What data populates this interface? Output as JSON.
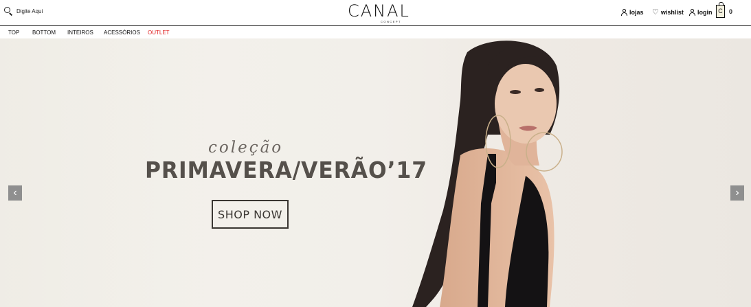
{
  "header": {
    "search_placeholder": "Digite Aqui",
    "logo_main": "CANAL",
    "logo_sub": "CONCEPT",
    "lojas": "lojas",
    "wishlist": "wishlist",
    "login": "login",
    "cart_count": "0",
    "cart_bag_letter": "C"
  },
  "nav": {
    "items": [
      "TOP",
      "BOTTOM",
      "INTEIROS",
      "ACESSÓRIOS",
      "OUTLET"
    ]
  },
  "hero": {
    "script_text": "coleção",
    "title": "PRIMAVERA/VERÃO’17",
    "cta": "SHOP NOW",
    "prev": "‹",
    "next": "›"
  },
  "colors": {
    "outlet": "#e02020",
    "arrow_bg": "#8f8f8f",
    "hero_text": "#55504b"
  }
}
